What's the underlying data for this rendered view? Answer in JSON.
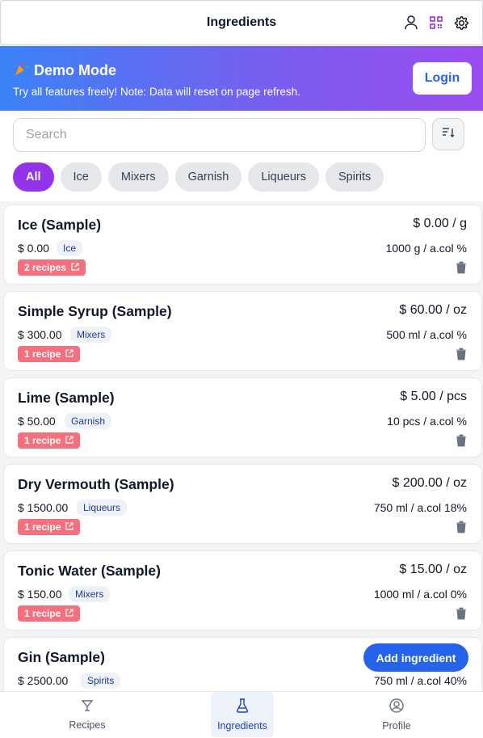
{
  "header": {
    "title": "Ingredients"
  },
  "banner": {
    "title": "Demo Mode",
    "subtitle": "Try all features freely! Note: Data will reset on page refresh.",
    "login_label": "Login"
  },
  "search": {
    "placeholder": "Search"
  },
  "filters": [
    "All",
    "Ice",
    "Mixers",
    "Garnish",
    "Liqueurs",
    "Spirits"
  ],
  "ingredients": [
    {
      "name": "Ice (Sample)",
      "unit_price": "$ 0.00 / g",
      "cost": "$ 0.00",
      "category": "Ice",
      "volume": "1000 g / a.col %",
      "recipes": "2 recipes"
    },
    {
      "name": "Simple Syrup (Sample)",
      "unit_price": "$ 60.00 / oz",
      "cost": "$ 300.00",
      "category": "Mixers",
      "volume": "500 ml / a.col %",
      "recipes": "1 recipe"
    },
    {
      "name": "Lime (Sample)",
      "unit_price": "$ 5.00 / pcs",
      "cost": "$ 50.00",
      "category": "Garnish",
      "volume": "10 pcs / a.col %",
      "recipes": "1 recipe"
    },
    {
      "name": "Dry Vermouth (Sample)",
      "unit_price": "$ 200.00 / oz",
      "cost": "$ 1500.00",
      "category": "Liqueurs",
      "volume": "750 ml / a.col 18%",
      "recipes": "1 recipe"
    },
    {
      "name": "Tonic Water (Sample)",
      "unit_price": "$ 15.00 / oz",
      "cost": "$ 150.00",
      "category": "Mixers",
      "volume": "1000 ml / a.col 0%",
      "recipes": "1 recipe"
    },
    {
      "name": "Gin (Sample)",
      "unit_price": "",
      "cost": "$ 2500.00",
      "category": "Spirits",
      "volume": "750 ml / a.col 40%",
      "recipes": ""
    }
  ],
  "fab_label": "Add ingredient",
  "nav": {
    "recipes": "Recipes",
    "ingredients": "Ingredients",
    "profile": "Profile"
  },
  "colors": {
    "accent": "#9333ea",
    "primary": "#2563eb",
    "recipe_badge": "#f4707f"
  }
}
